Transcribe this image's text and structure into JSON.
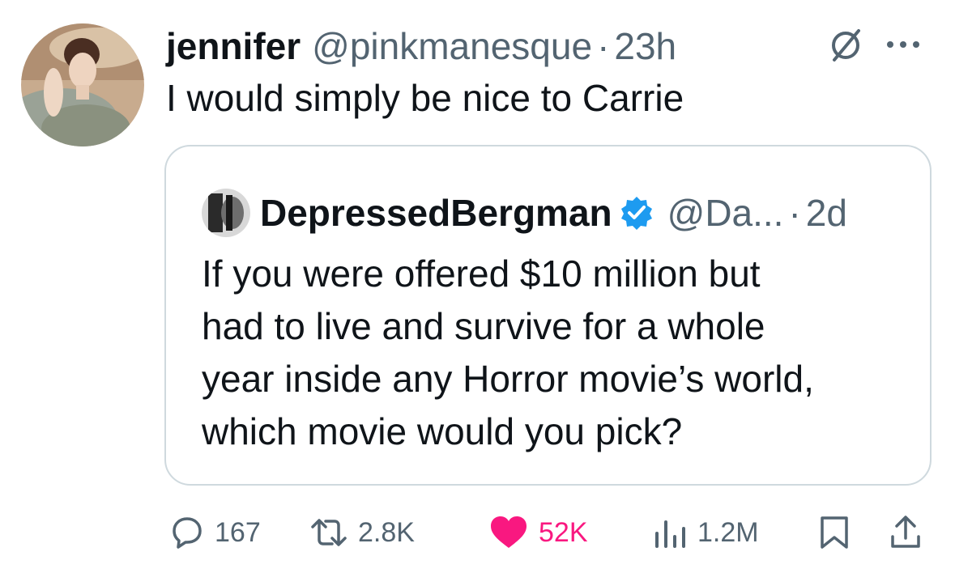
{
  "post": {
    "author_name": "jennifer",
    "author_handle": "@pinkmanesque",
    "separator": "·",
    "time": "23h",
    "text": "I would simply be nice to Carrie",
    "avatar_icon": "user-avatar-photo",
    "grok_icon": "grok-slash-circle-icon",
    "more_icon": "more-dots-icon"
  },
  "quoted_post": {
    "author_name": "DepressedBergman",
    "verified": true,
    "verified_color": "#1d9bf0",
    "author_handle": "@Da...",
    "separator": "·",
    "time": "2d",
    "text_lines": [
      "If you were offered $10 million but",
      "had to live and survive for a whole",
      "year inside any Horror movie’s world,",
      "which movie would you pick?"
    ]
  },
  "actions": {
    "replies": "167",
    "reposts": "2.8K",
    "likes": "52K",
    "liked": true,
    "like_color": "#f91880",
    "views": "1.2M",
    "bookmark_icon": "bookmark-icon",
    "share_icon": "share-icon"
  },
  "colors": {
    "text": "#0f1419",
    "secondary": "#536471",
    "border": "#cfd9de"
  }
}
